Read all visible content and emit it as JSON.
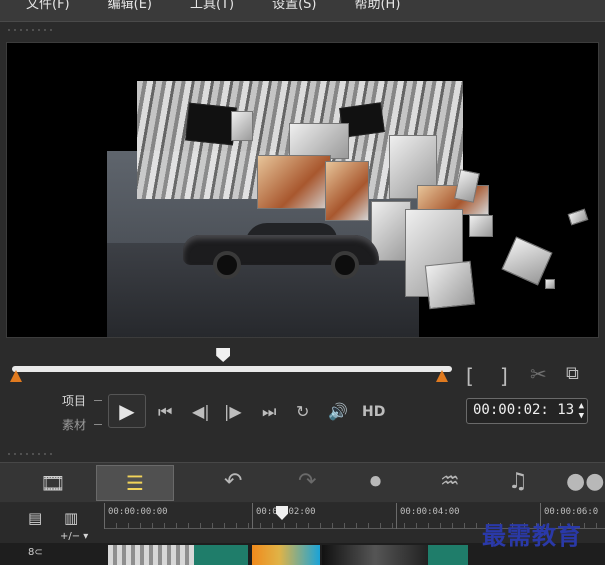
{
  "menu": {
    "items": [
      "文件(F)",
      "编辑(E)",
      "工具(T)",
      "设置(S)",
      "帮助(H)"
    ]
  },
  "playback": {
    "mode_project": "项目",
    "mode_clip": "素材",
    "hd_label": "HD",
    "timecode": "00:00:02: 13",
    "scrub_progress": 0.48
  },
  "timeline": {
    "ruler_marks": [
      "00:00:00:00",
      "00:00:02:00",
      "00:00:04:00",
      "00:00:06:0"
    ],
    "track_toggle_label": "+/− ▾"
  },
  "icons": {
    "play": "play-icon",
    "home": "go-to-start-icon",
    "prev_frame": "previous-frame-icon",
    "next_frame": "next-frame-icon",
    "end": "go-to-end-icon",
    "repeat": "repeat-icon",
    "volume": "volume-icon",
    "mark_in": "mark-in-icon",
    "mark_out": "mark-out-icon",
    "cut": "scissors-icon",
    "copy": "copy-icon",
    "storyboard": "filmstrip-icon",
    "timeline_view": "timeline-view-icon",
    "undo": "undo-icon",
    "redo": "redo-icon",
    "record": "record-capture-icon",
    "audio_mixer": "sound-wave-icon",
    "music": "music-icon",
    "motion": "motion-track-icon"
  },
  "watermark": {
    "text": "最需教育"
  },
  "colors": {
    "accent_orange": "#e07a1f",
    "active_tool": "#f2d45a",
    "watermark": "#2a39a8"
  }
}
